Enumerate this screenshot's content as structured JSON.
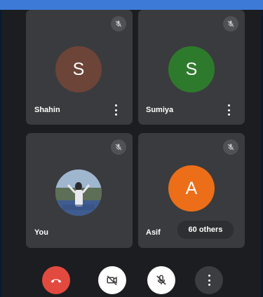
{
  "participants": [
    {
      "name": "Shahin",
      "initial": "S",
      "avatar_color": "#6d4438",
      "muted": true,
      "icon": "mic-off-icon"
    },
    {
      "name": "Sumiya",
      "initial": "S",
      "avatar_color": "#2e7a2c",
      "muted": true,
      "icon": "mic-off-icon"
    },
    {
      "name": "You",
      "initial": "",
      "avatar_kind": "photo",
      "muted": true,
      "icon": "mic-off-icon"
    },
    {
      "name": "Asif",
      "initial": "A",
      "avatar_color": "#ec6e18",
      "muted": true,
      "icon": "mic-off-icon"
    }
  ],
  "others_chip": "60 others",
  "controls": [
    {
      "name": "end-call",
      "icon": "phone-hangup-icon",
      "bg": "#e24a3f"
    },
    {
      "name": "camera",
      "icon": "video-off-icon",
      "bg": "#ffffff"
    },
    {
      "name": "microphone",
      "icon": "mic-off-icon",
      "bg": "#ffffff"
    },
    {
      "name": "more-options",
      "icon": "more-vert-icon",
      "bg": "#3c3d40"
    }
  ],
  "colors": {
    "frame_blue": "#3d7ad8",
    "tile": "#3a3b3e",
    "background": "#1c1d20"
  }
}
